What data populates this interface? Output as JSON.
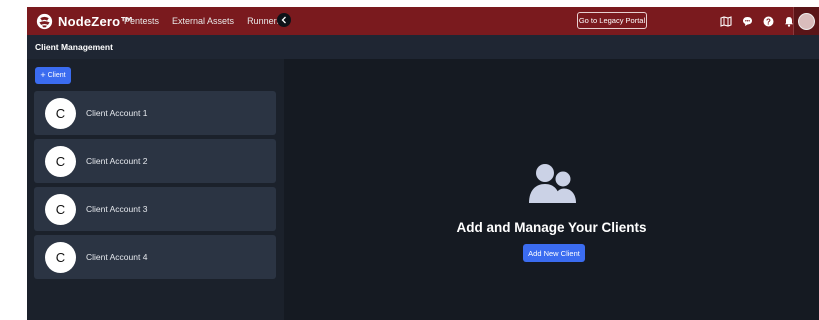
{
  "app": {
    "logo_text": "NodeZero™"
  },
  "nav": {
    "items": [
      {
        "label": "Pentests"
      },
      {
        "label": "External Assets"
      },
      {
        "label": "Runners"
      }
    ],
    "legacy_button": "Go to Legacy Portal",
    "icons": [
      "map-icon",
      "chat-icon",
      "help-icon",
      "bell-icon"
    ]
  },
  "subheader": {
    "title": "Client Management"
  },
  "sidebar": {
    "add_button_icon": "+",
    "add_button_label": "Client",
    "clients": [
      {
        "initial": "C",
        "name": "Client Account 1"
      },
      {
        "initial": "C",
        "name": "Client Account 2"
      },
      {
        "initial": "C",
        "name": "Client Account 3"
      },
      {
        "initial": "C",
        "name": "Client Account 4"
      }
    ]
  },
  "main": {
    "heading": "Add and Manage Your Clients",
    "button_label": "Add New Client"
  },
  "colors": {
    "topbar": "#7a1a1e",
    "accent": "#3b6cf0",
    "sidebar": "#1b212b",
    "card": "#2b3443",
    "main_bg": "#151a22"
  }
}
